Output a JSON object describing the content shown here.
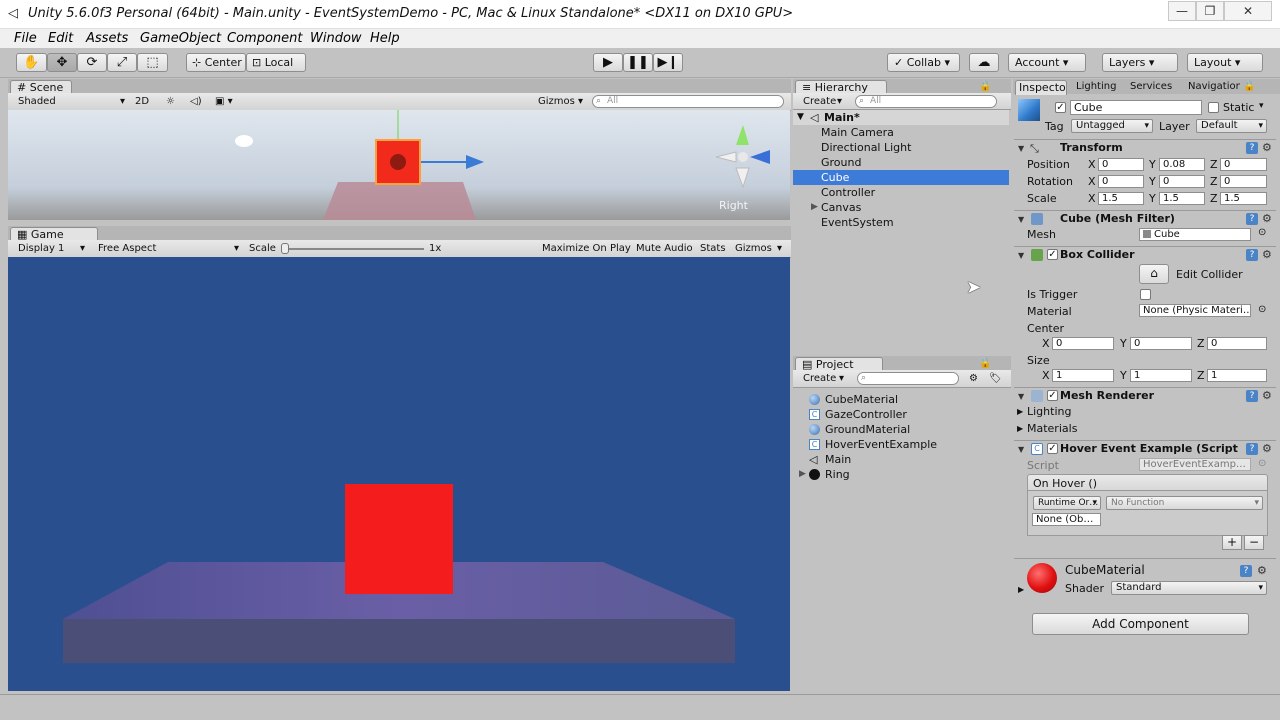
{
  "window": {
    "title": "Unity 5.6.0f3 Personal (64bit) - Main.unity - EventSystemDemo - PC, Mac & Linux Standalone* <DX11 on DX10 GPU>",
    "minimize": "—",
    "maximize": "❐",
    "close": "✕"
  },
  "menu": [
    "File",
    "Edit",
    "Assets",
    "GameObject",
    "Component",
    "Window",
    "Help"
  ],
  "toolbar": {
    "pivot": "Center",
    "space": "Local",
    "collab": "Collab",
    "account": "Account",
    "layers": "Layers",
    "layout": "Layout"
  },
  "scene": {
    "tab": "Scene",
    "shading": "Shaded",
    "mode2d": "2D",
    "gizmos": "Gizmos",
    "search_placeholder": "All",
    "view_label": "Right"
  },
  "game": {
    "tab": "Game",
    "display": "Display 1",
    "aspect": "Free Aspect",
    "scale_label": "Scale",
    "scale_value": "1x",
    "maximize": "Maximize On Play",
    "mute": "Mute Audio",
    "stats": "Stats",
    "gizmos": "Gizmos"
  },
  "hierarchy": {
    "tab": "Hierarchy",
    "create": "Create",
    "search_placeholder": "All",
    "scene": "Main*",
    "items": [
      "Main Camera",
      "Directional Light",
      "Ground",
      "Cube",
      "Controller",
      "Canvas",
      "EventSystem"
    ],
    "selected": "Cube"
  },
  "project": {
    "tab": "Project",
    "create": "Create",
    "items": [
      "CubeMaterial",
      "GazeController",
      "GroundMaterial",
      "HoverEventExample",
      "Main",
      "Ring"
    ]
  },
  "inspector": {
    "tabs": [
      "Inspector",
      "Lighting",
      "Services",
      "Navigation"
    ],
    "object_name": "Cube",
    "static": "Static",
    "tag_label": "Tag",
    "tag": "Untagged",
    "layer_label": "Layer",
    "layer": "Default",
    "transform": {
      "title": "Transform",
      "position_label": "Position",
      "rotation_label": "Rotation",
      "scale_label": "Scale",
      "position": [
        "0",
        "0.08",
        "0"
      ],
      "rotation": [
        "0",
        "0",
        "0"
      ],
      "scale": [
        "1.5",
        "1.5",
        "1.5"
      ]
    },
    "mesh_filter": {
      "title": "Cube (Mesh Filter)",
      "mesh_label": "Mesh",
      "mesh": "Cube"
    },
    "box_collider": {
      "title": "Box Collider",
      "edit_label": "Edit Collider",
      "is_trigger_label": "Is Trigger",
      "material_label": "Material",
      "material": "None (Physic Materi…",
      "center_label": "Center",
      "center": [
        "0",
        "0",
        "0"
      ],
      "size_label": "Size",
      "size": [
        "1",
        "1",
        "1"
      ]
    },
    "mesh_renderer": {
      "title": "Mesh Renderer",
      "lighting": "Lighting",
      "materials": "Materials"
    },
    "hover_script": {
      "title": "Hover Event Example (Script)",
      "script_label": "Script",
      "script": "HoverEventExamp…",
      "event_label": "On Hover ()",
      "runtime": "Runtime Or…",
      "function": "No Function",
      "object": "None (Ob…",
      "add": "+",
      "remove": "−"
    },
    "material": {
      "name": "CubeMaterial",
      "shader_label": "Shader",
      "shader": "Standard"
    },
    "add_component": "Add Component"
  },
  "colors": {
    "selection": "#3d7bd9",
    "cube": "#f41c1c",
    "game_background": "#2a4f8f"
  }
}
